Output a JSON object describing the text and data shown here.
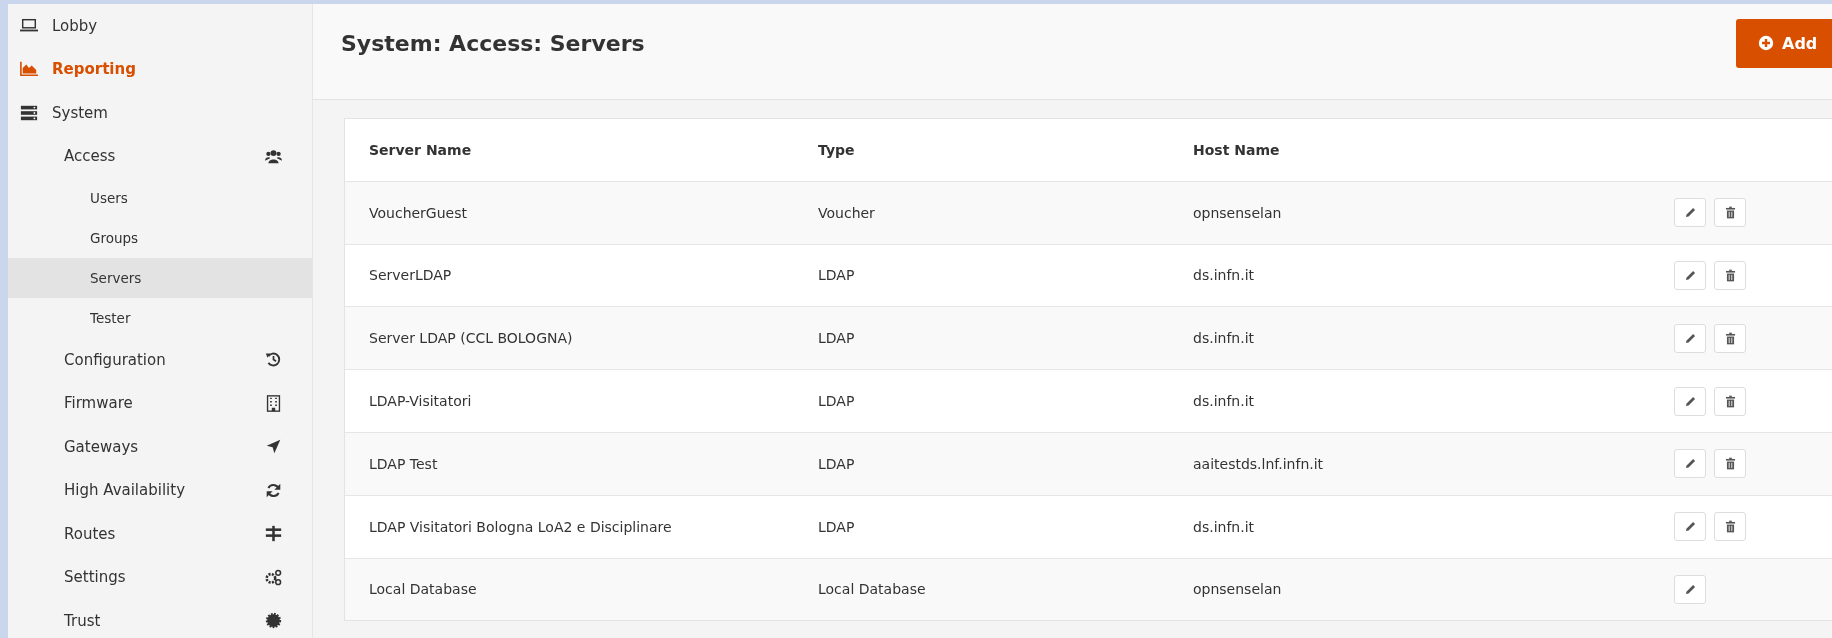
{
  "sidebar": {
    "items": [
      {
        "label": "Lobby",
        "selected": false,
        "highlighted": false
      },
      {
        "label": "Reporting",
        "selected": false,
        "highlighted": true
      },
      {
        "label": "System",
        "selected": false,
        "highlighted": false,
        "children": [
          {
            "label": "Access",
            "selected": false,
            "highlighted": false,
            "children": [
              {
                "label": "Users",
                "selected": false,
                "highlighted": false
              },
              {
                "label": "Groups",
                "selected": false,
                "highlighted": false
              },
              {
                "label": "Servers",
                "selected": true,
                "highlighted": false
              },
              {
                "label": "Tester",
                "selected": false,
                "highlighted": false
              }
            ]
          },
          {
            "label": "Configuration",
            "selected": false,
            "highlighted": false
          },
          {
            "label": "Firmware",
            "selected": false,
            "highlighted": false
          },
          {
            "label": "Gateways",
            "selected": false,
            "highlighted": false
          },
          {
            "label": "High Availability",
            "selected": false,
            "highlighted": false
          },
          {
            "label": "Routes",
            "selected": false,
            "highlighted": false
          },
          {
            "label": "Settings",
            "selected": false,
            "highlighted": false
          },
          {
            "label": "Trust",
            "selected": false,
            "highlighted": false
          }
        ]
      }
    ]
  },
  "page": {
    "title": "System: Access: Servers",
    "add_button": "Add"
  },
  "table": {
    "columns": [
      "Server Name",
      "Type",
      "Host Name"
    ],
    "rows": [
      {
        "cells": [
          "VoucherGuest",
          "Voucher",
          "opnsenselan"
        ],
        "deletable": true
      },
      {
        "cells": [
          "ServerLDAP",
          "LDAP",
          "ds.infn.it"
        ],
        "deletable": true
      },
      {
        "cells": [
          "Server LDAP (CCL BOLOGNA)",
          "LDAP",
          "ds.infn.it"
        ],
        "deletable": true
      },
      {
        "cells": [
          "LDAP-Visitatori",
          "LDAP",
          "ds.infn.it"
        ],
        "deletable": true
      },
      {
        "cells": [
          "LDAP Test",
          "LDAP",
          "aaitestds.lnf.infn.it"
        ],
        "deletable": true
      },
      {
        "cells": [
          "LDAP Visitatori Bologna LoA2 e Disciplinare",
          "LDAP",
          "ds.infn.it"
        ],
        "deletable": true
      },
      {
        "cells": [
          "Local Database",
          "Local Database",
          "opnsenselan"
        ],
        "deletable": false
      }
    ]
  }
}
